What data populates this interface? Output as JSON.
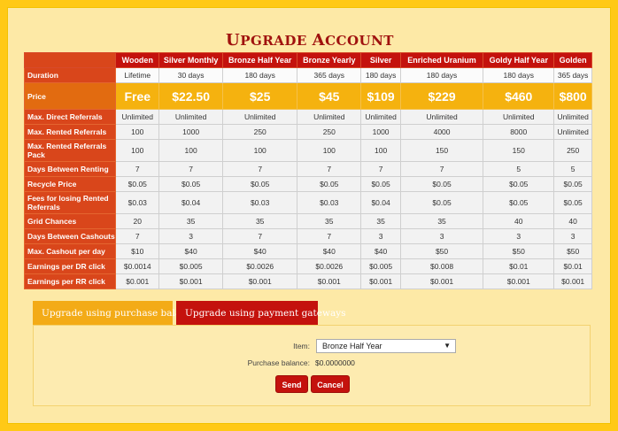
{
  "page": {
    "title_first": "U",
    "title_rest1": "PGRADE ",
    "title_second": "A",
    "title_rest2": "CCOUNT"
  },
  "table": {
    "headers": [
      "",
      "Wooden",
      "Silver Monthly",
      "Bronze Half Year",
      "Bronze Yearly",
      "Silver",
      "Enriched Uranium",
      "Goldy Half Year",
      "Golden"
    ],
    "rows": [
      {
        "label": "Duration",
        "values": [
          "Lifetime",
          "30 days",
          "180 days",
          "365 days",
          "180 days",
          "180 days",
          "180 days",
          "365 days"
        ]
      },
      {
        "label": "Price",
        "values": [
          "Free",
          "$22.50",
          "$25",
          "$45",
          "$109",
          "$229",
          "$460",
          "$800"
        ]
      },
      {
        "label": "Max. Direct Referrals",
        "values": [
          "Unlimited",
          "Unlimited",
          "Unlimited",
          "Unlimited",
          "Unlimited",
          "Unlimited",
          "Unlimited",
          "Unlimited"
        ]
      },
      {
        "label": "Max. Rented Referrals",
        "values": [
          "100",
          "1000",
          "250",
          "250",
          "1000",
          "4000",
          "8000",
          "Unlimited"
        ]
      },
      {
        "label": "Max. Rented Referrals Pack",
        "values": [
          "100",
          "100",
          "100",
          "100",
          "100",
          "150",
          "150",
          "250"
        ]
      },
      {
        "label": "Days Between Renting",
        "values": [
          "7",
          "7",
          "7",
          "7",
          "7",
          "7",
          "5",
          "5"
        ]
      },
      {
        "label": "Recycle Price",
        "values": [
          "$0.05",
          "$0.05",
          "$0.05",
          "$0.05",
          "$0.05",
          "$0.05",
          "$0.05",
          "$0.05"
        ]
      },
      {
        "label": "Fees for losing Rented Referrals",
        "values": [
          "$0.03",
          "$0.04",
          "$0.03",
          "$0.03",
          "$0.04",
          "$0.05",
          "$0.05",
          "$0.05"
        ]
      },
      {
        "label": "Grid Chances",
        "values": [
          "20",
          "35",
          "35",
          "35",
          "35",
          "35",
          "40",
          "40"
        ]
      },
      {
        "label": "Days Between Cashouts",
        "values": [
          "7",
          "3",
          "7",
          "7",
          "3",
          "3",
          "3",
          "3"
        ]
      },
      {
        "label": "Max. Cashout per day",
        "values": [
          "$10",
          "$40",
          "$40",
          "$40",
          "$40",
          "$50",
          "$50",
          "$50"
        ]
      },
      {
        "label": "Earnings per DR click",
        "values": [
          "$0.0014",
          "$0.005",
          "$0.0026",
          "$0.0026",
          "$0.005",
          "$0.008",
          "$0.01",
          "$0.01"
        ]
      },
      {
        "label": "Earnings per RR click",
        "values": [
          "$0.001",
          "$0.001",
          "$0.001",
          "$0.001",
          "$0.001",
          "$0.001",
          "$0.001",
          "$0.001"
        ]
      }
    ]
  },
  "tabs": {
    "purchase_balance": "Upgrade using purchase balance",
    "payment_gateways": "Upgrade using payment gateways"
  },
  "form": {
    "item_label": "Item:",
    "item_value": "Bronze Half Year",
    "balance_label": "Purchase balance:",
    "balance_value": "$0.0000000",
    "send_label": "Send",
    "cancel_label": "Cancel"
  },
  "colors": {
    "background": "#ffc916",
    "header_red": "#c4120d",
    "label_orange": "#d9461b",
    "price_gold": "#f5b20f",
    "tab_active": "#f3ab17"
  }
}
